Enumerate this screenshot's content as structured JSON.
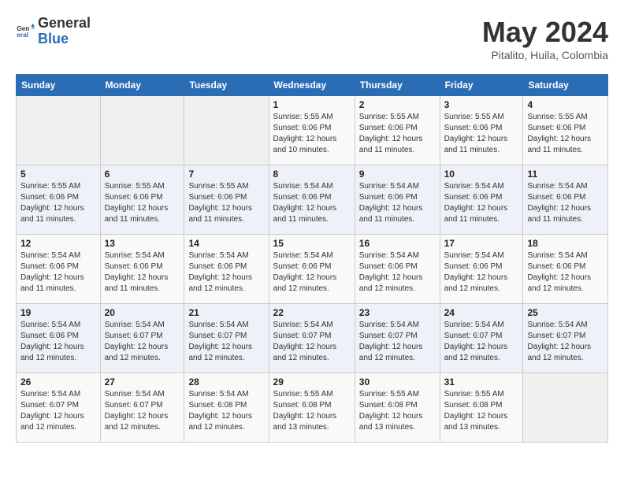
{
  "header": {
    "logo_general": "General",
    "logo_blue": "Blue",
    "month_year": "May 2024",
    "location": "Pitalito, Huila, Colombia"
  },
  "days_of_week": [
    "Sunday",
    "Monday",
    "Tuesday",
    "Wednesday",
    "Thursday",
    "Friday",
    "Saturday"
  ],
  "weeks": [
    [
      {
        "day": "",
        "info": ""
      },
      {
        "day": "",
        "info": ""
      },
      {
        "day": "",
        "info": ""
      },
      {
        "day": "1",
        "info": "Sunrise: 5:55 AM\nSunset: 6:06 PM\nDaylight: 12 hours\nand 10 minutes."
      },
      {
        "day": "2",
        "info": "Sunrise: 5:55 AM\nSunset: 6:06 PM\nDaylight: 12 hours\nand 11 minutes."
      },
      {
        "day": "3",
        "info": "Sunrise: 5:55 AM\nSunset: 6:06 PM\nDaylight: 12 hours\nand 11 minutes."
      },
      {
        "day": "4",
        "info": "Sunrise: 5:55 AM\nSunset: 6:06 PM\nDaylight: 12 hours\nand 11 minutes."
      }
    ],
    [
      {
        "day": "5",
        "info": "Sunrise: 5:55 AM\nSunset: 6:06 PM\nDaylight: 12 hours\nand 11 minutes."
      },
      {
        "day": "6",
        "info": "Sunrise: 5:55 AM\nSunset: 6:06 PM\nDaylight: 12 hours\nand 11 minutes."
      },
      {
        "day": "7",
        "info": "Sunrise: 5:55 AM\nSunset: 6:06 PM\nDaylight: 12 hours\nand 11 minutes."
      },
      {
        "day": "8",
        "info": "Sunrise: 5:54 AM\nSunset: 6:06 PM\nDaylight: 12 hours\nand 11 minutes."
      },
      {
        "day": "9",
        "info": "Sunrise: 5:54 AM\nSunset: 6:06 PM\nDaylight: 12 hours\nand 11 minutes."
      },
      {
        "day": "10",
        "info": "Sunrise: 5:54 AM\nSunset: 6:06 PM\nDaylight: 12 hours\nand 11 minutes."
      },
      {
        "day": "11",
        "info": "Sunrise: 5:54 AM\nSunset: 6:06 PM\nDaylight: 12 hours\nand 11 minutes."
      }
    ],
    [
      {
        "day": "12",
        "info": "Sunrise: 5:54 AM\nSunset: 6:06 PM\nDaylight: 12 hours\nand 11 minutes."
      },
      {
        "day": "13",
        "info": "Sunrise: 5:54 AM\nSunset: 6:06 PM\nDaylight: 12 hours\nand 11 minutes."
      },
      {
        "day": "14",
        "info": "Sunrise: 5:54 AM\nSunset: 6:06 PM\nDaylight: 12 hours\nand 12 minutes."
      },
      {
        "day": "15",
        "info": "Sunrise: 5:54 AM\nSunset: 6:06 PM\nDaylight: 12 hours\nand 12 minutes."
      },
      {
        "day": "16",
        "info": "Sunrise: 5:54 AM\nSunset: 6:06 PM\nDaylight: 12 hours\nand 12 minutes."
      },
      {
        "day": "17",
        "info": "Sunrise: 5:54 AM\nSunset: 6:06 PM\nDaylight: 12 hours\nand 12 minutes."
      },
      {
        "day": "18",
        "info": "Sunrise: 5:54 AM\nSunset: 6:06 PM\nDaylight: 12 hours\nand 12 minutes."
      }
    ],
    [
      {
        "day": "19",
        "info": "Sunrise: 5:54 AM\nSunset: 6:06 PM\nDaylight: 12 hours\nand 12 minutes."
      },
      {
        "day": "20",
        "info": "Sunrise: 5:54 AM\nSunset: 6:07 PM\nDaylight: 12 hours\nand 12 minutes."
      },
      {
        "day": "21",
        "info": "Sunrise: 5:54 AM\nSunset: 6:07 PM\nDaylight: 12 hours\nand 12 minutes."
      },
      {
        "day": "22",
        "info": "Sunrise: 5:54 AM\nSunset: 6:07 PM\nDaylight: 12 hours\nand 12 minutes."
      },
      {
        "day": "23",
        "info": "Sunrise: 5:54 AM\nSunset: 6:07 PM\nDaylight: 12 hours\nand 12 minutes."
      },
      {
        "day": "24",
        "info": "Sunrise: 5:54 AM\nSunset: 6:07 PM\nDaylight: 12 hours\nand 12 minutes."
      },
      {
        "day": "25",
        "info": "Sunrise: 5:54 AM\nSunset: 6:07 PM\nDaylight: 12 hours\nand 12 minutes."
      }
    ],
    [
      {
        "day": "26",
        "info": "Sunrise: 5:54 AM\nSunset: 6:07 PM\nDaylight: 12 hours\nand 12 minutes."
      },
      {
        "day": "27",
        "info": "Sunrise: 5:54 AM\nSunset: 6:07 PM\nDaylight: 12 hours\nand 12 minutes."
      },
      {
        "day": "28",
        "info": "Sunrise: 5:54 AM\nSunset: 6:08 PM\nDaylight: 12 hours\nand 12 minutes."
      },
      {
        "day": "29",
        "info": "Sunrise: 5:55 AM\nSunset: 6:08 PM\nDaylight: 12 hours\nand 13 minutes."
      },
      {
        "day": "30",
        "info": "Sunrise: 5:55 AM\nSunset: 6:08 PM\nDaylight: 12 hours\nand 13 minutes."
      },
      {
        "day": "31",
        "info": "Sunrise: 5:55 AM\nSunset: 6:08 PM\nDaylight: 12 hours\nand 13 minutes."
      },
      {
        "day": "",
        "info": ""
      }
    ]
  ]
}
